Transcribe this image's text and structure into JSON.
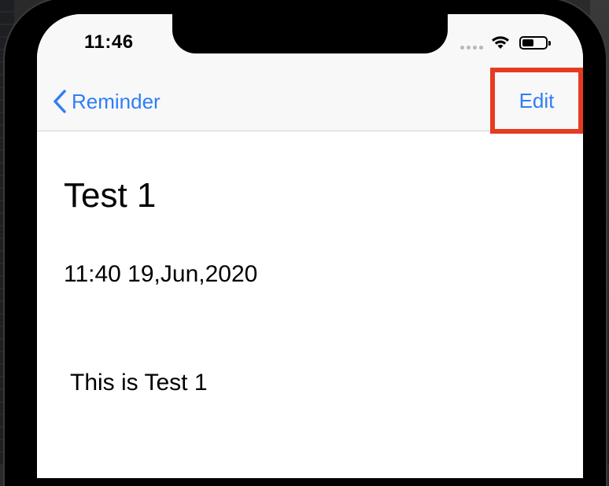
{
  "status_bar": {
    "time": "11:46"
  },
  "nav": {
    "back_label": "Reminder",
    "edit_label": "Edit"
  },
  "reminder": {
    "title": "Test 1",
    "datetime": "11:40 19,Jun,2020",
    "body": "This is Test 1"
  },
  "colors": {
    "accent": "#2f7ef6",
    "highlight_border": "#e63b22"
  },
  "icons": {
    "back": "chevron-left-icon",
    "wifi": "wifi-icon",
    "battery": "battery-icon"
  }
}
